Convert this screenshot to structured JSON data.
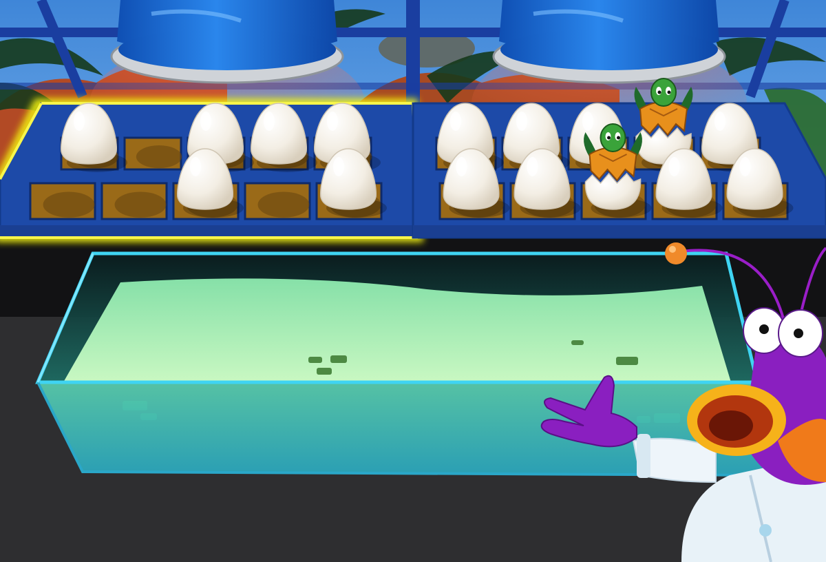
{
  "scene": {
    "name": "turtle-hatchery",
    "colors": {
      "sky": "#5aa0e6",
      "floor": "#2e2e30",
      "tray_frame": "#1d4aa8",
      "tray_highlight": "#f2f20a",
      "egg": "#f4efe6",
      "water_top": "#a9f0b0",
      "water_front": "#33c0c0",
      "heat_lamp": "#1a6fd6",
      "scientist": "#8a1fc0"
    }
  },
  "trays": [
    {
      "id": "left",
      "selected": true,
      "cells": [
        [
          "egg",
          "empty",
          "egg",
          "egg",
          "egg"
        ],
        [
          "empty",
          "empty",
          "egg",
          "empty",
          "egg"
        ]
      ]
    },
    {
      "id": "right",
      "selected": false,
      "cells": [
        [
          "egg",
          "egg",
          "egg",
          "hatchling",
          "egg"
        ],
        [
          "egg",
          "egg",
          "hatchling",
          "egg",
          "egg"
        ]
      ]
    }
  ],
  "heat_lamps": [
    {
      "id": "lamp-left",
      "icon": "heat-lamp-icon"
    },
    {
      "id": "lamp-right",
      "icon": "heat-lamp-icon"
    }
  ],
  "aquarium": {
    "state": "empty",
    "icon": "aquarium-icon"
  },
  "host": {
    "character": "scientist-mascot",
    "pose": "presenting",
    "icon": "scientist-icon"
  }
}
